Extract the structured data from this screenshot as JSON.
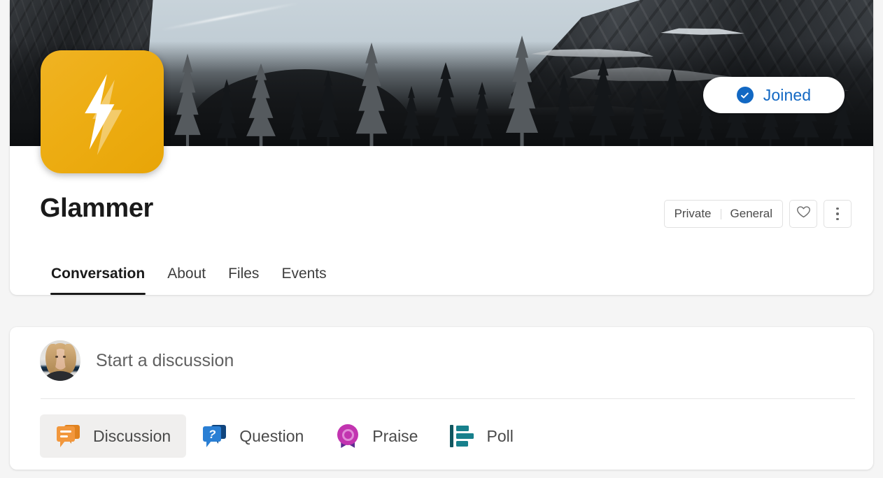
{
  "group": {
    "name": "Glammer",
    "avatar_icon": "lightning-bolt-icon",
    "avatar_color": "#edad13",
    "banner_alt": "snowy-mountain-forest-banner",
    "join_button": {
      "label": "Joined",
      "icon": "check-circle-icon",
      "accent_color": "#1268c3"
    },
    "privacy": "Private",
    "category": "General",
    "favorite_icon": "heart-icon",
    "more_icon": "more-vertical-icon"
  },
  "tabs": [
    {
      "label": "Conversation",
      "active": true
    },
    {
      "label": "About",
      "active": false
    },
    {
      "label": "Files",
      "active": false
    },
    {
      "label": "Events",
      "active": false
    }
  ],
  "composer": {
    "avatar_alt": "user-avatar-photo",
    "placeholder": "Start a discussion",
    "post_types": [
      {
        "label": "Discussion",
        "icon": "discussion-bubble-icon",
        "color": "#f2973c",
        "selected": true
      },
      {
        "label": "Question",
        "icon": "question-bubble-icon",
        "color": "#2a7fd4",
        "selected": false
      },
      {
        "label": "Praise",
        "icon": "praise-badge-icon",
        "color": "#c234b0",
        "selected": false
      },
      {
        "label": "Poll",
        "icon": "poll-bars-icon",
        "color": "#17808c",
        "selected": false
      }
    ]
  }
}
